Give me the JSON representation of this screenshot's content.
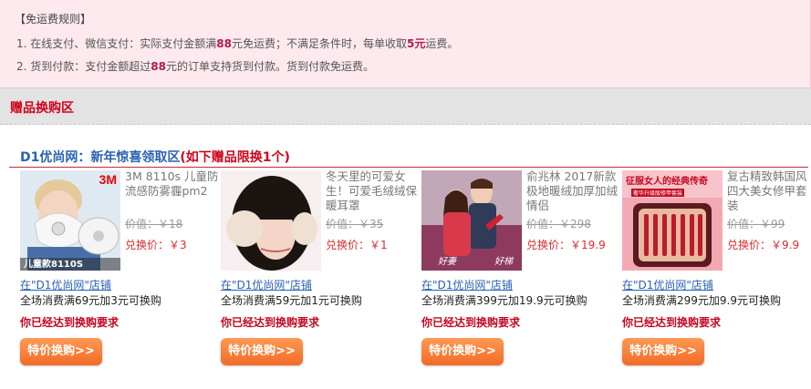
{
  "rules": {
    "heading": "【免运费规则】",
    "line1": {
      "a": "1. 在线支付、微信支付：实际支付金额满",
      "b": "88",
      "c": "元免运费；不满足条件时，每单收取",
      "d": "5元",
      "e": "运费。"
    },
    "line2": {
      "a": "2. 货到付款：支付金额超过",
      "b": "88",
      "c": "元的订单支持货到付款。货到付款免运费。"
    }
  },
  "zone": {
    "title": "赠品换购区"
  },
  "section": {
    "title_a": "D1优尚网：新年惊喜领取区",
    "title_b": "(如下赠品限换1个)"
  },
  "products": [
    {
      "name": "3M 8110s 儿童防流感防雾霾pm2",
      "price": "价值：￥18",
      "sale": "兑换价：￥3",
      "shop": "在\"D1优尚网\"店铺",
      "condition": "全场消费满69元加3元可换购",
      "ok": "你已经达到换购要求",
      "button": "特价换购>>",
      "image_label": "儿童款8110S",
      "brand": "3M"
    },
    {
      "name": "冬天里的可爱女生！可爱毛绒绒保暖耳罩",
      "price": "价值：￥35",
      "sale": "兑换价：￥1",
      "shop": "在\"D1优尚网\"店铺",
      "condition": "全场消费满59元加1元可换购",
      "ok": "你已经达到换购要求",
      "button": "特价换购>>"
    },
    {
      "name": "俞兆林 2017新款极地暖绒加厚加绒情侣",
      "price": "价值：￥298",
      "sale": "兑换价：￥19.9",
      "shop": "在\"D1优尚网\"店铺",
      "condition": "全场消费满399元加19.9元可换购",
      "ok": "你已经达到换购要求",
      "button": "特价换购>>",
      "image_text_a": "好妻",
      "image_text_b": "好梯"
    },
    {
      "name": "复古精致韩国风四大美女修甲套装",
      "price": "价值：￥99",
      "sale": "兑换价：￥9.9",
      "shop": "在\"D1优尚网\"店铺",
      "condition": "全场消费满299元加9.9元可换购",
      "ok": "你已经达到换购要求",
      "button": "特价换购>>",
      "image_title": "征服女人的经典传奇",
      "image_sub": "奢华升级版修甲套装"
    }
  ],
  "colors": {
    "accent": "#d0021b",
    "link": "#2a61b3",
    "button": "#f26a25",
    "rules_bg": "#fde9ee"
  }
}
